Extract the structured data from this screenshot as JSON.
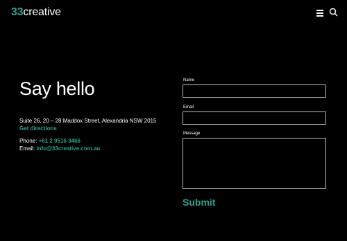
{
  "header": {
    "logo_number": "33",
    "logo_word": "creative",
    "menu_icon": "hamburger-icon",
    "search_icon": "search-icon"
  },
  "contact": {
    "title": "Say hello",
    "address": "Suite 26, 20 – 28 Maddox Street, Alexandria NSW 2015",
    "directions_label": "Get directions",
    "phone_label": "Phone:",
    "phone_value": "+61 2 9516 3466",
    "email_label": "Email:",
    "email_value": "info@33creative.com.au"
  },
  "form": {
    "name_label": "Name",
    "name_value": "",
    "email_label": "Email",
    "email_value": "",
    "message_label": "Message",
    "message_value": "",
    "submit_label": "Submit"
  },
  "colors": {
    "background": "#000000",
    "accent": "#2ea08f",
    "text": "#ffffff",
    "field_border": "#bfbfbf"
  }
}
